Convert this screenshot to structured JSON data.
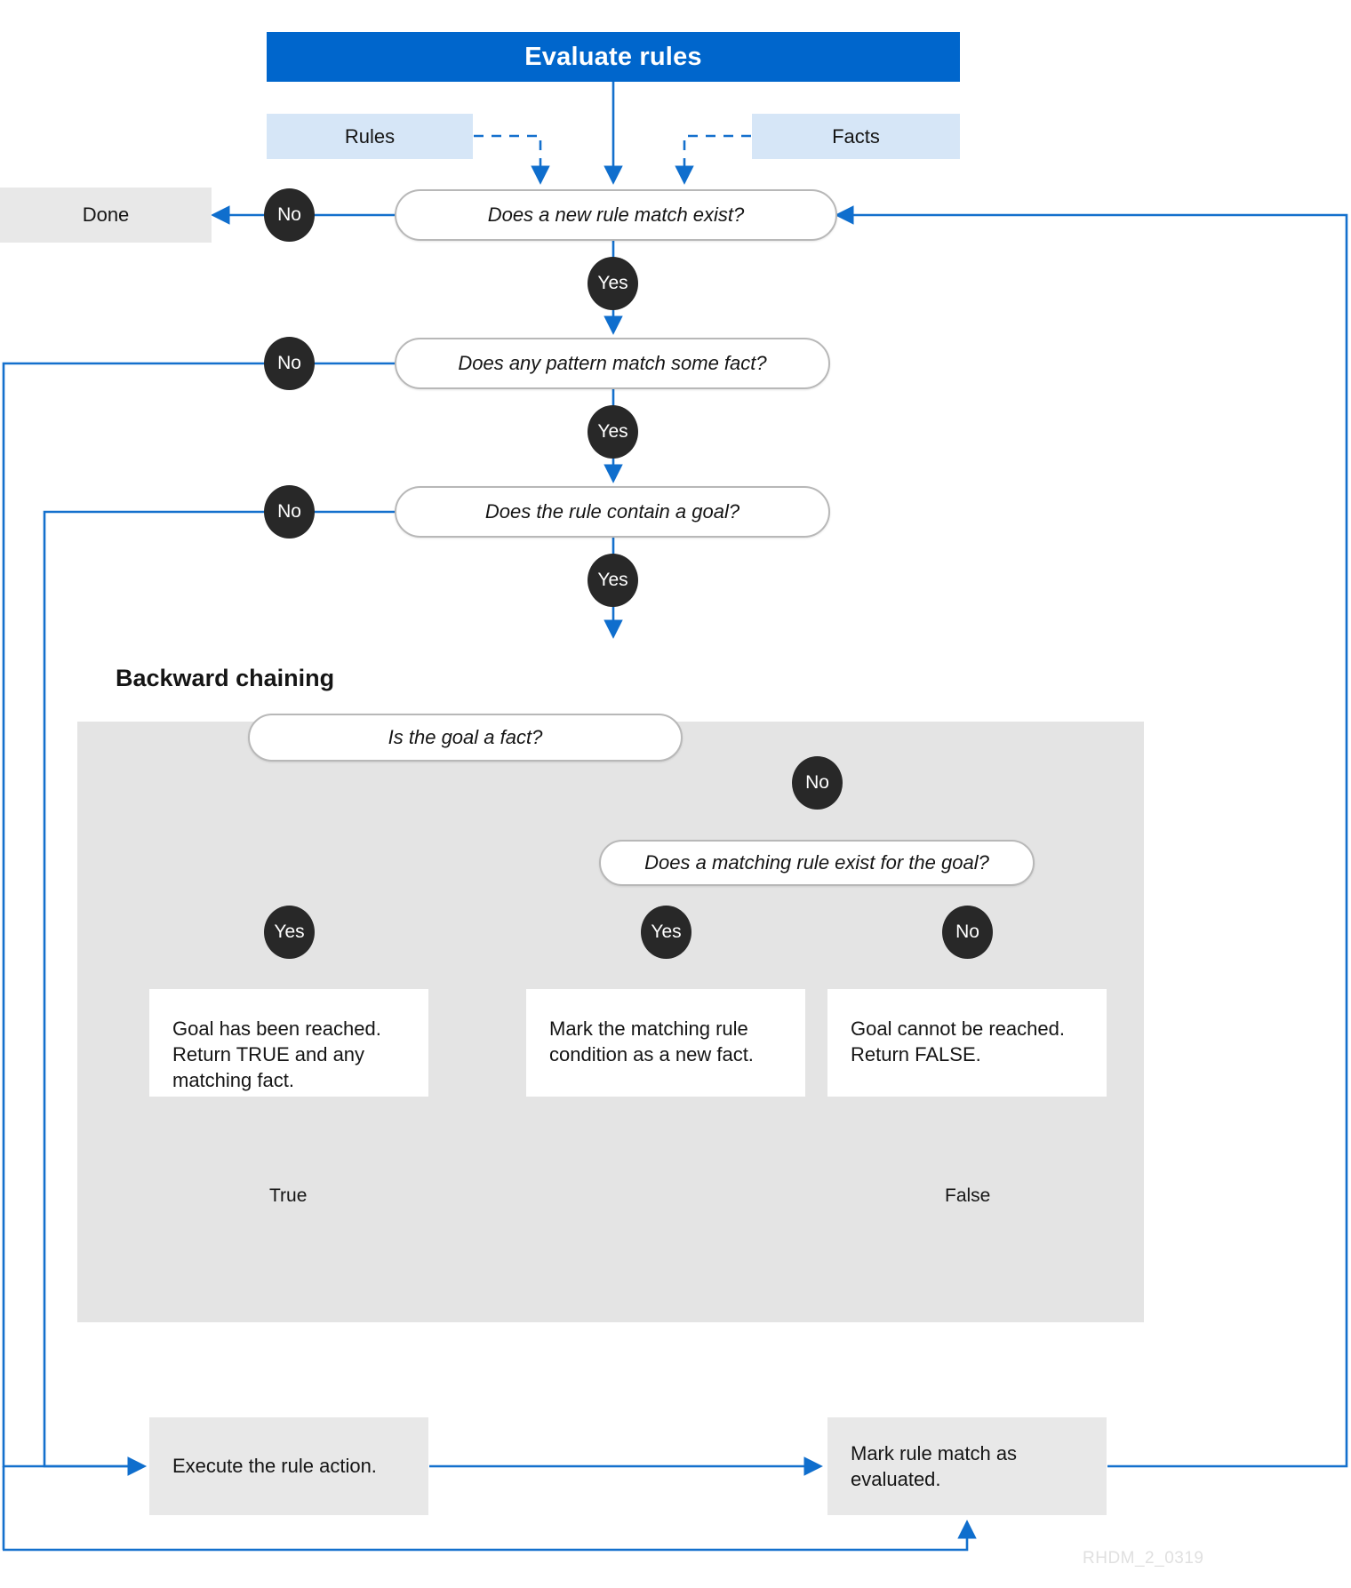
{
  "diagram": {
    "title": "Evaluate rules",
    "watermark": "RHDM_2_0319",
    "accent_color": "#0066cc",
    "panel_color": "#e4e4e4",
    "badge_color": "#282828",
    "input_color": "#d6e6f7",
    "action_color": "#e8e8e8"
  },
  "inputs": [
    {
      "label": "Rules"
    },
    {
      "label": "Facts"
    }
  ],
  "terminals": [
    {
      "label": "Done"
    }
  ],
  "decisions": [
    {
      "id": "new-rule-match",
      "label": "Does a new rule match exist?"
    },
    {
      "id": "pattern-match",
      "label": "Does any pattern match some fact?"
    },
    {
      "id": "rule-goal",
      "label": "Does the rule contain a goal?"
    },
    {
      "id": "goal-fact",
      "label": "Is the goal a fact?"
    },
    {
      "id": "matching-rule",
      "label": "Does a matching rule exist for the goal?"
    }
  ],
  "subprocess": {
    "title": "Backward chaining",
    "results": [
      {
        "id": "goal-reached",
        "label": "Goal has been reached. Return TRUE and any matching fact."
      },
      {
        "id": "new-fact",
        "label": "Mark the matching rule condition as a new fact."
      },
      {
        "id": "goal-unreachable",
        "label": "Goal cannot be reached. Return FALSE."
      }
    ]
  },
  "actions": [
    {
      "id": "execute-rule",
      "label": "Execute the rule action."
    },
    {
      "id": "mark-evaluated",
      "label": "Mark rule match as evaluated."
    }
  ],
  "branch_badges": [
    {
      "id": "no-new-rule-match",
      "label": "No"
    },
    {
      "id": "yes-new-rule-match",
      "label": "Yes"
    },
    {
      "id": "no-pattern-match",
      "label": "No"
    },
    {
      "id": "yes-pattern-match",
      "label": "Yes"
    },
    {
      "id": "no-rule-goal",
      "label": "No"
    },
    {
      "id": "yes-rule-goal",
      "label": "Yes"
    },
    {
      "id": "no-goal-fact",
      "label": "No"
    },
    {
      "id": "yes-goal-fact",
      "label": "Yes"
    },
    {
      "id": "yes-matching-rule",
      "label": "Yes"
    },
    {
      "id": "no-matching-rule",
      "label": "No"
    }
  ],
  "edge_labels": [
    {
      "id": "true-label",
      "label": "True"
    },
    {
      "id": "false-label",
      "label": "False"
    }
  ]
}
